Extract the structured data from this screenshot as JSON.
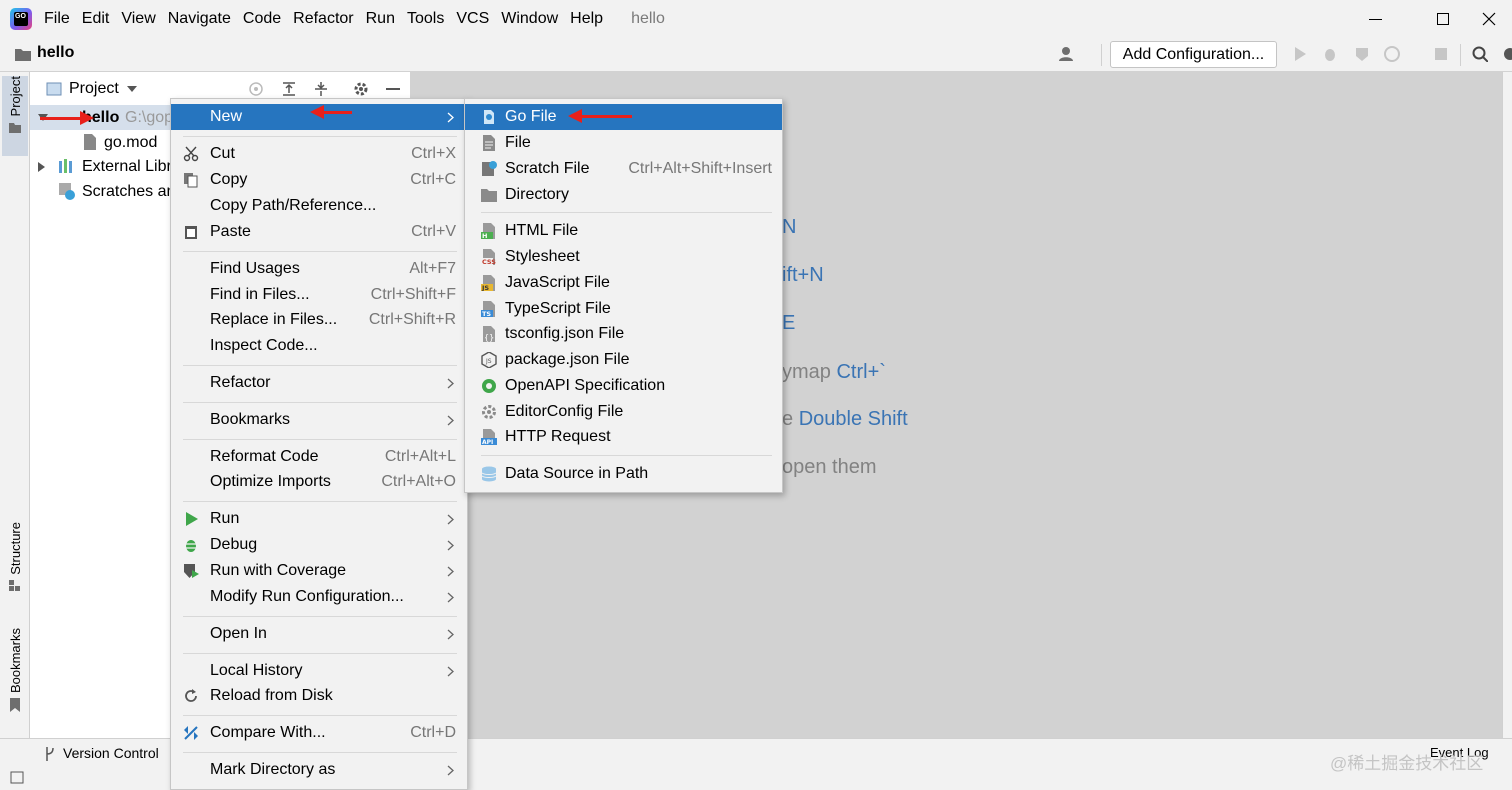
{
  "menubar": {
    "items": [
      "File",
      "Edit",
      "View",
      "Navigate",
      "Code",
      "Refactor",
      "Run",
      "Tools",
      "VCS",
      "Window",
      "Help"
    ],
    "underlines": [
      "F",
      "E",
      "V",
      "N",
      "C",
      "R",
      "R",
      "T",
      "",
      "W",
      "H"
    ],
    "project_title": "hello",
    "minimize": "—",
    "maximize": "☐",
    "close": "✕"
  },
  "toolbar": {
    "breadcrumb": "hello",
    "add_config_label": "Add Configuration...",
    "icons": [
      "user-icon",
      "play-icon",
      "debug-icon",
      "coverage-icon",
      "profile-icon",
      "stop-icon",
      "search-icon",
      "settings-icon"
    ]
  },
  "left_stripe": {
    "project_tab": "Project",
    "structure_tab": "Structure",
    "bookmarks_tab": "Bookmarks"
  },
  "project_panel": {
    "title": "Project",
    "tree": [
      {
        "label": "hello",
        "suffix": "G:\\gop",
        "bold": true
      },
      {
        "label": "go.mod",
        "suffix": ""
      },
      {
        "label": "External Libr",
        "suffix": ""
      },
      {
        "label": "Scratches an",
        "suffix": ""
      }
    ]
  },
  "editor_hints": [
    {
      "text": "",
      "shortcut": "N"
    },
    {
      "text": "",
      "shortcut": "ift+N"
    },
    {
      "text": "",
      "shortcut": "E"
    },
    {
      "text": "ymap ",
      "shortcut": "Ctrl+`"
    },
    {
      "text": "e ",
      "shortcut": "Double Shift"
    },
    {
      "text": "open them",
      "shortcut": ""
    }
  ],
  "context_menu": {
    "items": [
      {
        "label": "New",
        "shortcut": "",
        "submenu": true,
        "selected": true
      },
      {
        "label": "Cut",
        "shortcut": "Ctrl+X",
        "icon": "scissors-icon",
        "u": "t"
      },
      {
        "label": "Copy",
        "shortcut": "Ctrl+C",
        "icon": "copy-icon",
        "u": "C"
      },
      {
        "label": "Copy Path/Reference...",
        "shortcut": ""
      },
      {
        "label": "Paste",
        "shortcut": "Ctrl+V",
        "icon": "clipboard-icon",
        "u": "P"
      },
      {
        "label": "Find Usages",
        "shortcut": "Alt+F7",
        "u": "U"
      },
      {
        "label": "Find in Files...",
        "shortcut": "Ctrl+Shift+F"
      },
      {
        "label": "Replace in Files...",
        "shortcut": "Ctrl+Shift+R",
        "u": "a"
      },
      {
        "label": "Inspect Code...",
        "shortcut": "",
        "u": "I"
      },
      {
        "label": "Refactor",
        "shortcut": "",
        "submenu": true,
        "u": "R"
      },
      {
        "label": "Bookmarks",
        "shortcut": "",
        "submenu": true
      },
      {
        "label": "Reformat Code",
        "shortcut": "Ctrl+Alt+L",
        "u": "R"
      },
      {
        "label": "Optimize Imports",
        "shortcut": "Ctrl+Alt+O",
        "u": "z"
      },
      {
        "label": "Run",
        "shortcut": "",
        "submenu": true,
        "icon": "run-icon",
        "u": "R"
      },
      {
        "label": "Debug",
        "shortcut": "",
        "submenu": true,
        "icon": "debug-icon",
        "u": "D"
      },
      {
        "label": "Run with Coverage",
        "shortcut": "",
        "submenu": true,
        "icon": "coverage-icon",
        "u": "v"
      },
      {
        "label": "Modify Run Configuration...",
        "shortcut": "",
        "submenu": true
      },
      {
        "label": "Open In",
        "shortcut": "",
        "submenu": true
      },
      {
        "label": "Local History",
        "shortcut": "",
        "submenu": true,
        "u": "H"
      },
      {
        "label": "Reload from Disk",
        "shortcut": "",
        "icon": "reload-icon"
      },
      {
        "label": "Compare With...",
        "shortcut": "Ctrl+D",
        "icon": "compare-icon"
      },
      {
        "label": "Mark Directory as",
        "shortcut": "",
        "submenu": true
      }
    ]
  },
  "new_submenu": {
    "items": [
      {
        "label": "Go File",
        "shortcut": "",
        "icon": "go-file-icon",
        "selected": true
      },
      {
        "label": "File",
        "shortcut": "",
        "icon": "file-icon"
      },
      {
        "label": "Scratch File",
        "shortcut": "Ctrl+Alt+Shift+Insert",
        "icon": "scratch-file-icon"
      },
      {
        "label": "Directory",
        "shortcut": "",
        "icon": "folder-icon"
      },
      {
        "label": "HTML File",
        "shortcut": "",
        "icon": "html-file-icon"
      },
      {
        "label": "Stylesheet",
        "shortcut": "",
        "icon": "css-file-icon"
      },
      {
        "label": "JavaScript File",
        "shortcut": "",
        "icon": "js-file-icon"
      },
      {
        "label": "TypeScript File",
        "shortcut": "",
        "icon": "ts-file-icon"
      },
      {
        "label": "tsconfig.json File",
        "shortcut": "",
        "icon": "tsconfig-icon"
      },
      {
        "label": "package.json File",
        "shortcut": "",
        "icon": "package-json-icon"
      },
      {
        "label": "OpenAPI Specification",
        "shortcut": "",
        "icon": "openapi-icon"
      },
      {
        "label": "EditorConfig File",
        "shortcut": "",
        "icon": "editorconfig-icon"
      },
      {
        "label": "HTTP Request",
        "shortcut": "",
        "icon": "api-icon"
      },
      {
        "label": "Data Source in Path",
        "shortcut": "",
        "icon": "database-icon"
      }
    ]
  },
  "statusbar": {
    "version_control": "Version Control",
    "event_log": "Event Log",
    "watermark": "@稀土掘金技术社区"
  },
  "colors": {
    "selection": "#2675bf",
    "link": "#3a74b4",
    "annotation_arrow": "#e8201a"
  }
}
